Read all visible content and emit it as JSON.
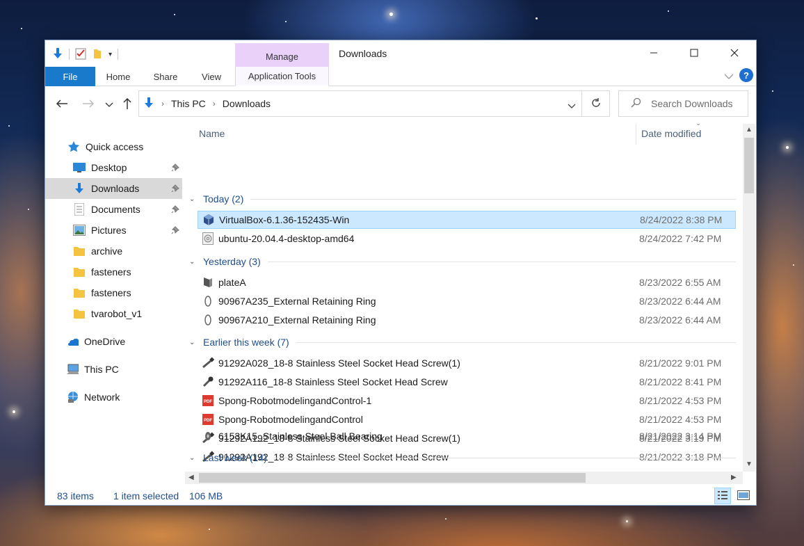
{
  "window": {
    "title": "Downloads",
    "contextual_tab_header": "Manage",
    "ribbon_tabs": [
      {
        "label": "File"
      },
      {
        "label": "Home"
      },
      {
        "label": "Share"
      },
      {
        "label": "View"
      },
      {
        "label": "Application Tools"
      }
    ]
  },
  "address": {
    "crumbs": [
      "This PC",
      "Downloads"
    ],
    "search_placeholder": "Search Downloads"
  },
  "navpane": {
    "items": [
      {
        "label": "Quick access",
        "icon": "star-icon"
      },
      {
        "label": "Desktop",
        "icon": "desktop-icon",
        "pinned": true
      },
      {
        "label": "Downloads",
        "icon": "download-arrow-icon",
        "pinned": true,
        "selected": true
      },
      {
        "label": "Documents",
        "icon": "documents-icon",
        "pinned": true
      },
      {
        "label": "Pictures",
        "icon": "pictures-icon",
        "pinned": true
      },
      {
        "label": "archive",
        "icon": "folder-icon"
      },
      {
        "label": "fasteners",
        "icon": "folder-icon"
      },
      {
        "label": "fasteners",
        "icon": "folder-icon"
      },
      {
        "label": "tvarobot_v1",
        "icon": "folder-icon"
      },
      {
        "label": "OneDrive",
        "icon": "cloud-icon"
      },
      {
        "label": "This PC",
        "icon": "computer-icon"
      },
      {
        "label": "Network",
        "icon": "network-icon"
      }
    ]
  },
  "list": {
    "col_name": "Name",
    "col_date": "Date modified",
    "groups": [
      {
        "label": "Today (2)",
        "files": [
          {
            "name": "VirtualBox-6.1.36-152435-Win",
            "date": "8/24/2022 8:38 PM",
            "icon": "virtualbox-icon",
            "selected": true
          },
          {
            "name": "ubuntu-20.04.4-desktop-amd64",
            "date": "8/24/2022 7:42 PM",
            "icon": "disc-image-icon"
          }
        ]
      },
      {
        "label": "Yesterday (3)",
        "files": [
          {
            "name": "plateA",
            "date": "8/23/2022 6:55 AM",
            "icon": "cad-part-icon"
          },
          {
            "name": "90967A235_External Retaining Ring",
            "date": "8/23/2022 6:44 AM",
            "icon": "ring-icon"
          },
          {
            "name": "90967A210_External Retaining Ring",
            "date": "8/23/2022 6:44 AM",
            "icon": "ring-icon"
          }
        ]
      },
      {
        "label": "Earlier this week (7)",
        "files": [
          {
            "name": "91292A028_18-8 Stainless Steel Socket Head Screw(1)",
            "date": "8/21/2022 9:01 PM",
            "icon": "screw-icon"
          },
          {
            "name": "91292A116_18-8 Stainless Steel Socket Head Screw",
            "date": "8/21/2022 8:41 PM",
            "icon": "screw-icon"
          },
          {
            "name": "Spong-RobotmodelingandControl-1",
            "date": "8/21/2022 4:53 PM",
            "icon": "pdf-icon"
          },
          {
            "name": "Spong-RobotmodelingandControl",
            "date": "8/21/2022 4:53 PM",
            "icon": "pdf-icon"
          },
          {
            "name": "91292A192_18-8 Stainless Steel Socket Head Screw(1)",
            "date": "8/21/2022 3:19 PM",
            "icon": "screw-icon"
          },
          {
            "name": "91292A192_18-8 Stainless Steel Socket Head Screw",
            "date": "8/21/2022 3:18 PM",
            "icon": "screw-icon"
          },
          {
            "name": "6153K15_Stainless Steel Ball Bearing",
            "date": "8/21/2022 3:14 PM",
            "icon": "bearing-icon"
          }
        ]
      },
      {
        "label": "Last week (14)",
        "files": []
      }
    ]
  },
  "status": {
    "item_count": "83 items",
    "selection": "1 item selected",
    "size": "106 MB"
  }
}
